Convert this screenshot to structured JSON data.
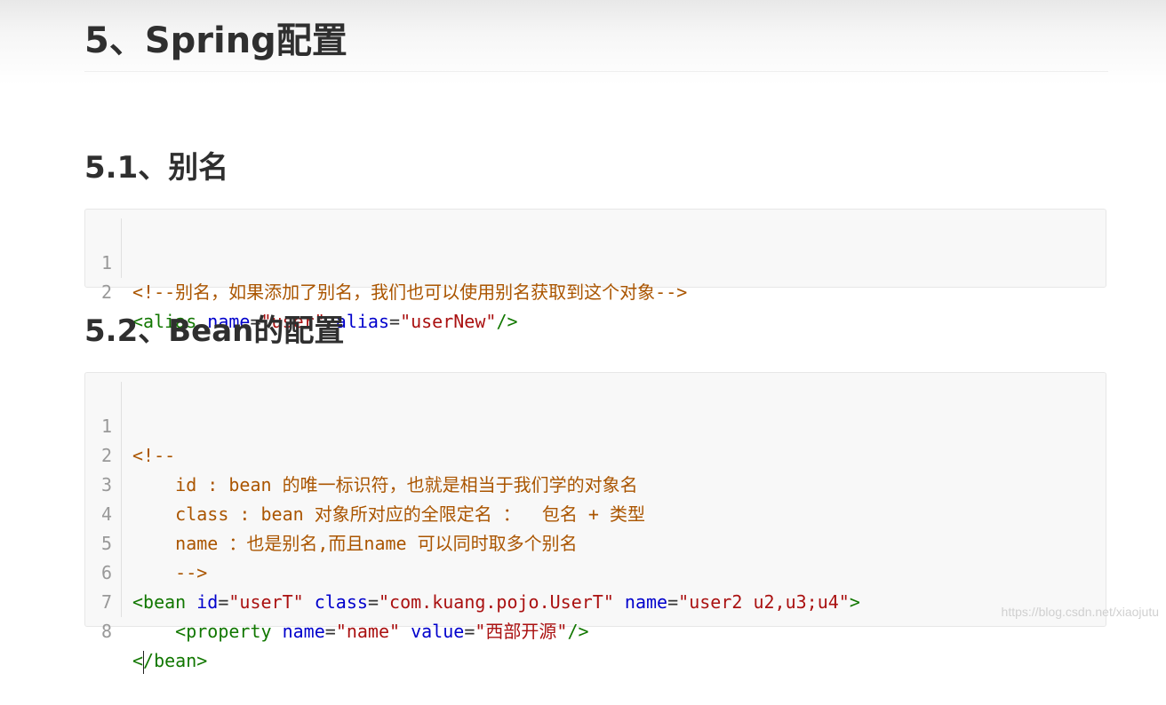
{
  "page": {
    "title": "5、Spring配置",
    "watermark": "https://blog.csdn.net/xiaojutu"
  },
  "sections": {
    "alias": {
      "heading": "5.1、别名",
      "lines": [
        {
          "num": "1",
          "comment": "<!--别名，如果添加了别名，我们也可以使用别名获取到这个对象-->"
        },
        {
          "num": "2",
          "tag_open": "<alias",
          "attr1": " name",
          "eq1": "=",
          "val1": "\"user\"",
          "attr2": " alias",
          "eq2": "=",
          "val2": "\"userNew\"",
          "tag_close": "/>"
        }
      ]
    },
    "bean": {
      "heading": "5.2、Bean的配置",
      "lines": [
        {
          "num": "1",
          "text": "<!--"
        },
        {
          "num": "2",
          "text": "    id : bean 的唯一标识符，也就是相当于我们学的对象名"
        },
        {
          "num": "3",
          "text": "    class : bean 对象所对应的全限定名 ：  包名 + 类型"
        },
        {
          "num": "4",
          "text": "    name ：也是别名,而且name 可以同时取多个别名"
        },
        {
          "num": "5",
          "text": "    -->"
        },
        {
          "num": "6",
          "tag_open": "<bean",
          "attr1": " id",
          "eq1": "=",
          "val1": "\"userT\"",
          "attr2": " class",
          "eq2": "=",
          "val2": "\"com.kuang.pojo.UserT\"",
          "attr3": " name",
          "eq3": "=",
          "val3": "\"user2 u2,u3;u4\"",
          "tag_close": ">"
        },
        {
          "num": "7",
          "indent": "    ",
          "tag_open": "<property",
          "attr1": " name",
          "eq1": "=",
          "val1": "\"name\"",
          "attr2": " value",
          "eq2": "=",
          "val2": "\"西部开源\"",
          "tag_close": "/>"
        },
        {
          "num": "8",
          "lt": "<",
          "tag": "/bean",
          "gt": ">"
        }
      ]
    }
  },
  "colors": {
    "comment": "#aa5500",
    "tag": "#117700",
    "attr": "#0000cc",
    "string": "#aa1111"
  }
}
